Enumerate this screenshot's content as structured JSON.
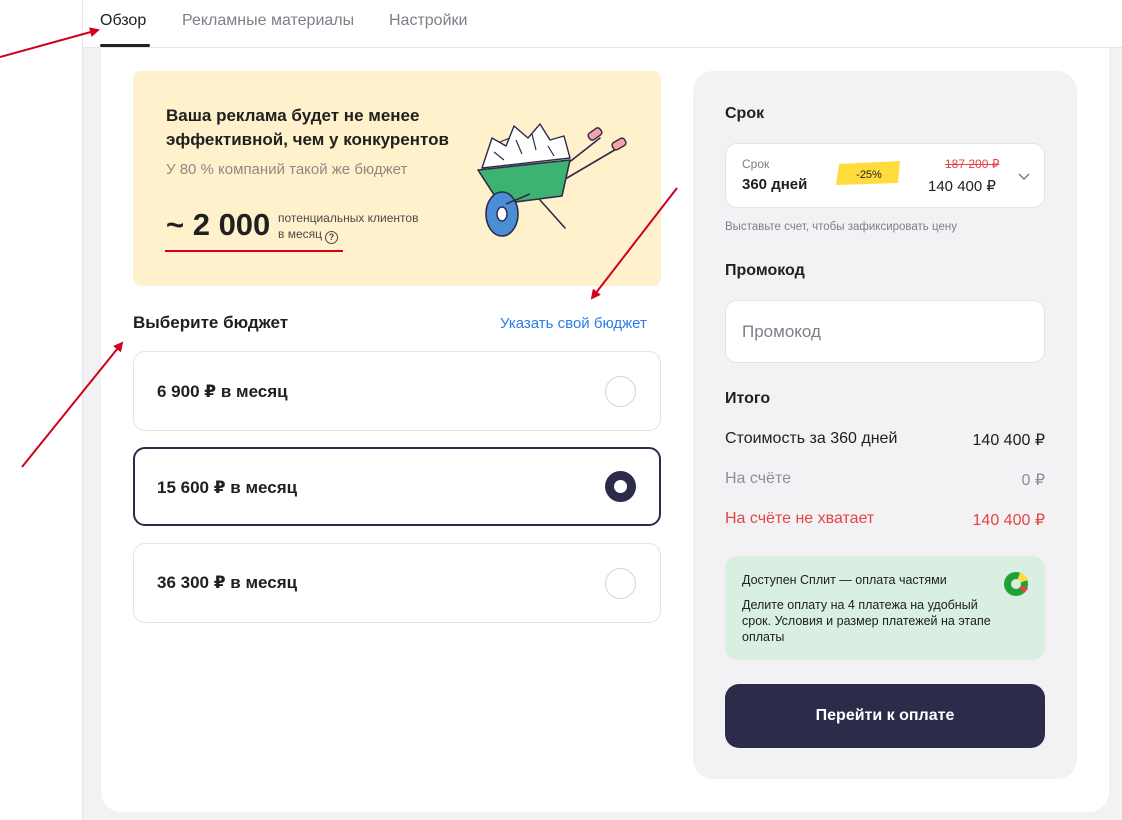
{
  "tabs": [
    {
      "label": "Обзор",
      "active": true
    },
    {
      "label": "Рекламные материалы",
      "active": false
    },
    {
      "label": "Настройки",
      "active": false
    }
  ],
  "promo": {
    "title": "Ваша реклама будет не менее эффективной, чем у конкурентов",
    "subtitle": "У 80 % компаний такой же бюджет",
    "clients_number": "~ 2 000",
    "clients_caption_line1": "потенциальных клиентов",
    "clients_caption_line2": "в месяц",
    "help_icon": "question-icon"
  },
  "budget": {
    "title": "Выберите бюджет",
    "custom_link": "Указать свой бюджет",
    "options": [
      {
        "label": "6 900 ₽ в месяц",
        "selected": false
      },
      {
        "label": "15 600 ₽ в месяц",
        "selected": true
      },
      {
        "label": "36 300 ₽ в месяц",
        "selected": false
      }
    ]
  },
  "term": {
    "heading": "Срок",
    "caption": "Срок",
    "value": "360 дней",
    "discount": "-25%",
    "old_price": "187 200 ₽",
    "new_price": "140 400 ₽",
    "note": "Выставьте счет, чтобы зафиксировать цену"
  },
  "promocode": {
    "heading": "Промокод",
    "placeholder": "Промокод"
  },
  "summary": {
    "heading": "Итого",
    "rows": [
      {
        "label": "Стоимость за 360 дней",
        "value": "140 400 ₽",
        "tone": "dark"
      },
      {
        "label": "На счёте",
        "value": "0 ₽",
        "tone": "grey"
      },
      {
        "label": "На счёте не хватает",
        "value": "140 400 ₽",
        "tone": "red"
      }
    ]
  },
  "split": {
    "title": "Доступен Сплит — оплата частями",
    "text": "Делите оплату на 4 платежа на удобный срок. Условия и размер платежей на этапе оплаты"
  },
  "pay_button": "Перейти к оплате",
  "colors": {
    "accent_dark": "#2c2c4a",
    "link": "#2b7de9",
    "promo_bg": "#fff1cc",
    "error": "#e34542",
    "split_bg": "#d8efe2",
    "annotation": "#d0021b"
  }
}
